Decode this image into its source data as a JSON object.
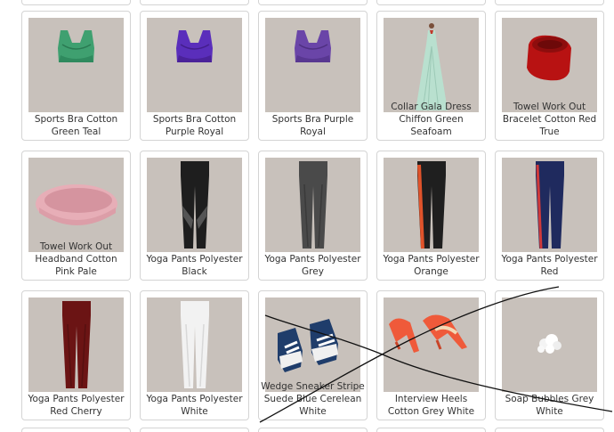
{
  "products": [
    {
      "name": "Sports Bra Cotton Green Teal",
      "icon": "green-sports-bra-icon",
      "color": "#3fa070"
    },
    {
      "name": "Sports Bra Cotton Purple Royal",
      "icon": "purple-sports-bra-icon",
      "color": "#5a2ebb"
    },
    {
      "name": "Sports Bra Purple Royal",
      "icon": "purple-sports-bra-icon",
      "color": "#6a45a8"
    },
    {
      "name": "Collar Gala Dress Chiffon Green Seafoam",
      "icon": "gala-dress-icon",
      "color": "#b9e0cf"
    },
    {
      "name": "Towel Work Out Bracelet Cotton Red True",
      "icon": "red-wristband-icon",
      "color": "#b81212"
    },
    {
      "name": "Towel Work Out Headband Cotton Pink Pale",
      "icon": "pink-headband-icon",
      "color": "#e7aeb7"
    },
    {
      "name": "Yoga Pants Polyester Black",
      "icon": "black-yoga-pants-icon",
      "color": "#1e1e1e"
    },
    {
      "name": "Yoga Pants Polyester Grey",
      "icon": "grey-yoga-pants-icon",
      "color": "#4a4a4a"
    },
    {
      "name": "Yoga Pants Polyester Orange",
      "icon": "orange-stripe-yoga-pants-icon",
      "color": "#1f1f1f"
    },
    {
      "name": "Yoga Pants Polyester Red",
      "icon": "navy-red-stripe-yoga-pants-icon",
      "color": "#1f2a5e"
    },
    {
      "name": "Yoga Pants Polyester Red Cherry",
      "icon": "red-cherry-yoga-pants-icon",
      "color": "#6b1414"
    },
    {
      "name": "Yoga Pants Polyester White",
      "icon": "white-yoga-pants-icon",
      "color": "#f2f2f2"
    },
    {
      "name": "Wedge Sneaker Stripe Suede Blue Cerelean White",
      "icon": "wedge-sneakers-icon",
      "color": "#1f3d6b"
    },
    {
      "name": "Interview Heels Cotton Grey White",
      "icon": "orange-heels-icon",
      "color": "#ef5a3a"
    },
    {
      "name": "Soap Bubbles Grey White",
      "icon": "soap-bubbles-icon",
      "color": "#f4f4f4"
    }
  ],
  "thumb_background": "#c8c1bb"
}
